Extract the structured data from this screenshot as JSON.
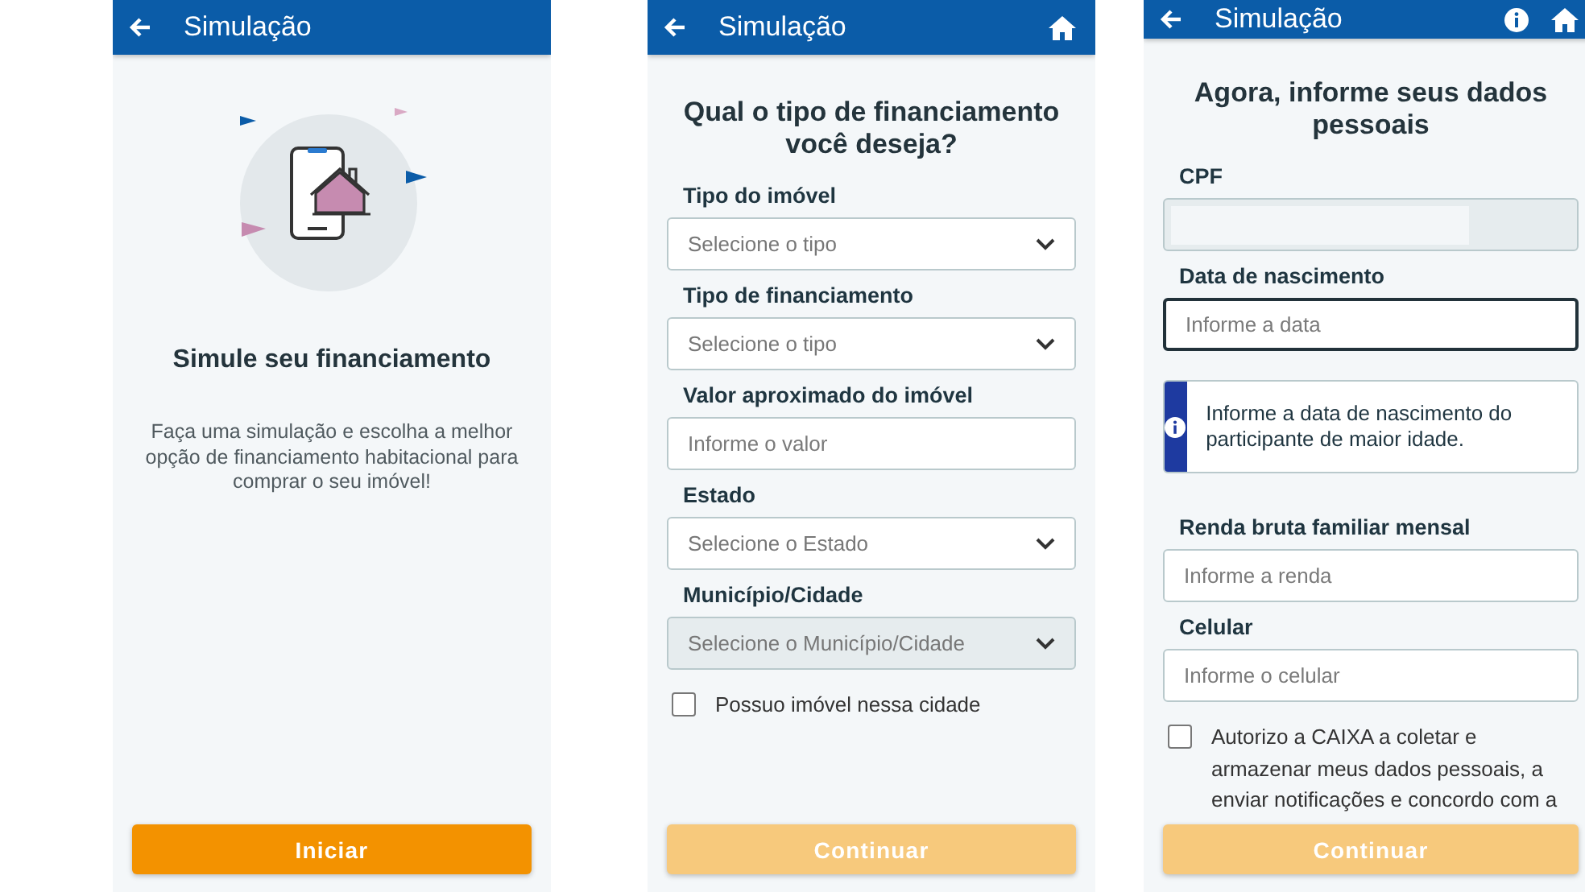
{
  "screens": [
    {
      "kind": "intro",
      "scrolled": false,
      "header": {
        "title": "Simulação"
      },
      "heading": "Simule seu financiamento",
      "description": "Faça uma simulação e escolha a melhor opção de financiamento habitacional para comprar o seu imóvel!",
      "button": {
        "label": "Iniciar",
        "disabled": false
      }
    },
    {
      "kind": "form",
      "scrolled": false,
      "header": {
        "title": "Simulação",
        "actions": [
          {
            "kind": "home"
          }
        ]
      },
      "heading": "Qual o tipo de financiamento você deseja?",
      "fields": [
        {
          "kind": "select",
          "label": "Tipo do imóvel",
          "placeholder": "Selecione o tipo",
          "disabled": false,
          "focused": false
        },
        {
          "kind": "select",
          "label": "Tipo de financiamento",
          "placeholder": "Selecione o tipo",
          "disabled": false,
          "focused": false
        },
        {
          "kind": "text",
          "label": "Valor aproximado do imóvel",
          "placeholder": "Informe o valor",
          "disabled": false,
          "focused": false,
          "redacted": false
        },
        {
          "kind": "select",
          "label": "Estado",
          "placeholder": "Selecione o Estado",
          "disabled": false,
          "focused": false
        },
        {
          "kind": "select",
          "label": "Município/Cidade",
          "placeholder": "Selecione o Município/Cidade",
          "disabled": true,
          "focused": false
        }
      ],
      "checkbox": {
        "label": "Possuo imóvel nessa cidade",
        "checked": false
      },
      "button": {
        "label": "Continuar",
        "disabled": true
      }
    },
    {
      "kind": "form",
      "scrolled": true,
      "header": {
        "title": "Simulação",
        "actions": [
          {
            "kind": "info"
          },
          {
            "kind": "home"
          }
        ]
      },
      "heading": "Agora, informe seus dados pessoais",
      "fields": [
        {
          "kind": "text",
          "label": "CPF",
          "disabled": true,
          "focused": false,
          "redacted": true
        },
        {
          "kind": "text",
          "label": "Data de nascimento",
          "placeholder": "Informe a data",
          "disabled": false,
          "focused": true,
          "redacted": false
        },
        {
          "kind": "note",
          "text": "Informe a data de nascimento do participante de maior idade."
        },
        {
          "kind": "text",
          "label": "Renda bruta familiar mensal",
          "placeholder": "Informe a renda",
          "disabled": false,
          "focused": false,
          "redacted": false
        },
        {
          "kind": "text",
          "label": "Celular",
          "placeholder": "Informe o celular",
          "disabled": false,
          "focused": false,
          "redacted": false
        }
      ],
      "checkbox": {
        "label": "Autorizo a CAIXA a coletar e armazenar meus dados pessoais, a enviar notificações e concordo com a",
        "checked": false
      },
      "button": {
        "label": "Continuar",
        "disabled": true
      }
    }
  ]
}
